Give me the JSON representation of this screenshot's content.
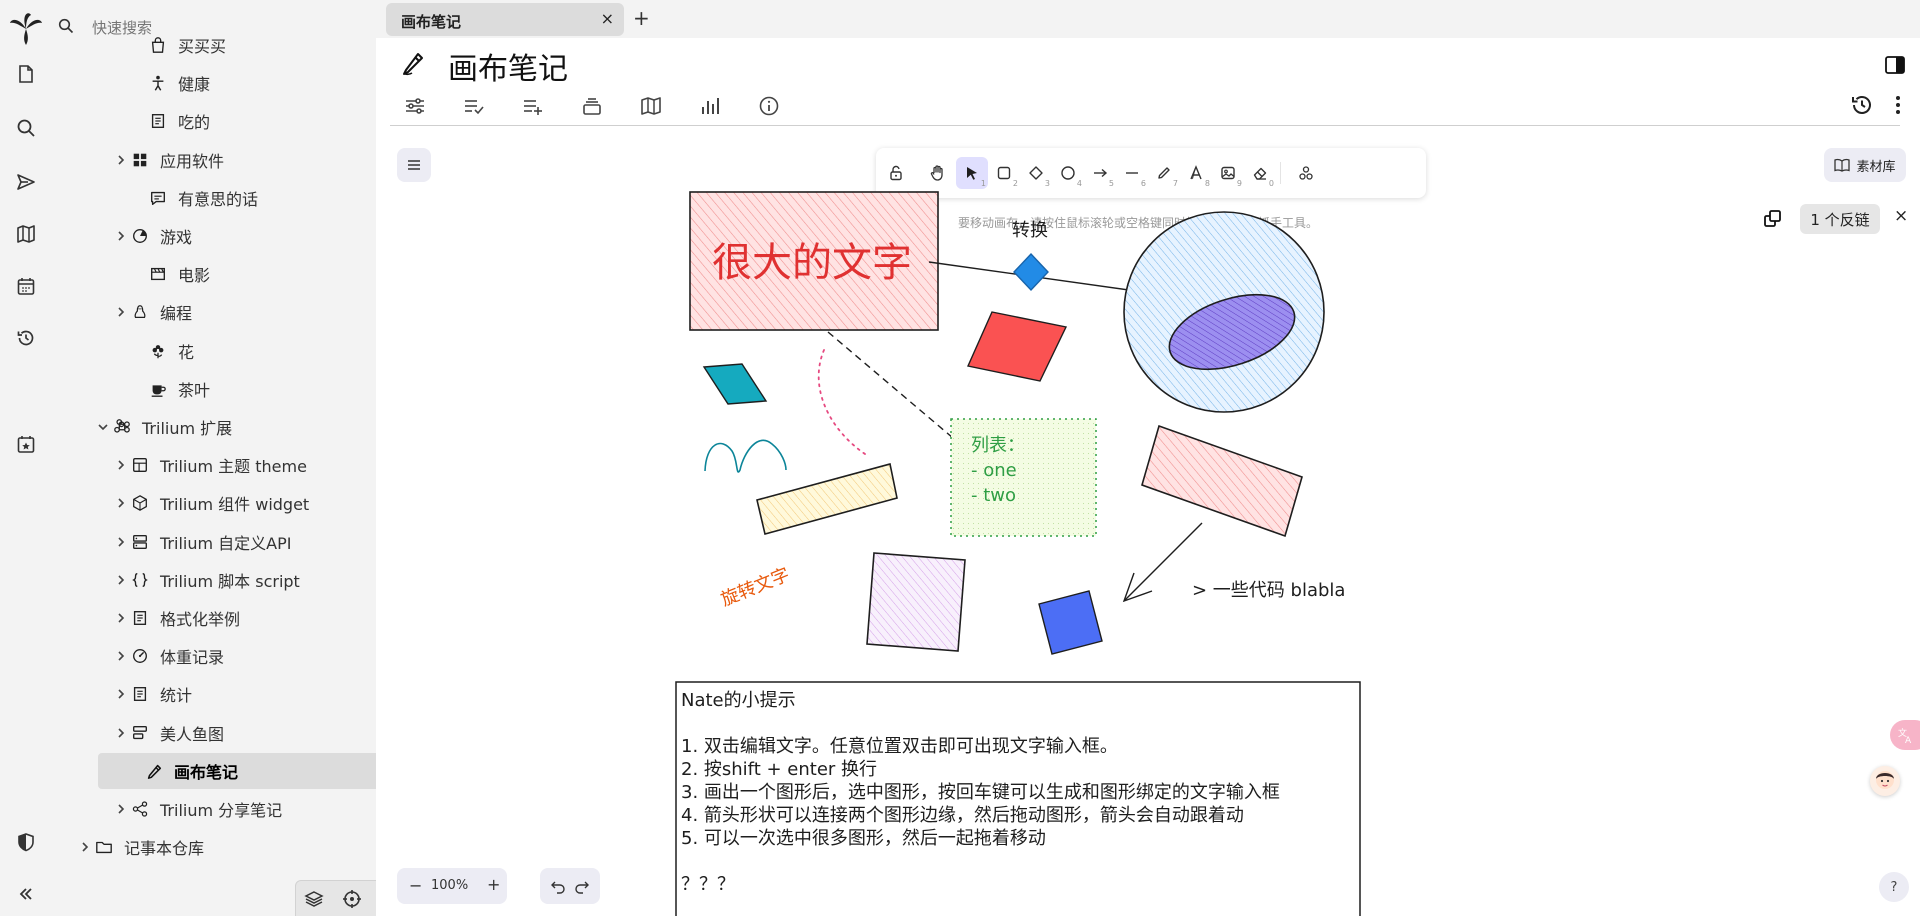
{
  "search": {
    "placeholder": "快速搜索"
  },
  "tree": {
    "items": [
      {
        "label": "买买买",
        "expandable": false
      },
      {
        "label": "健康",
        "expandable": false
      },
      {
        "label": "吃的",
        "expandable": false
      },
      {
        "label": "应用软件",
        "expandable": true
      },
      {
        "label": "有意思的话",
        "expandable": false
      },
      {
        "label": "游戏",
        "expandable": true
      },
      {
        "label": "电影",
        "expandable": false
      },
      {
        "label": "编程",
        "expandable": true
      },
      {
        "label": "花",
        "expandable": false
      },
      {
        "label": "茶叶",
        "expandable": false
      },
      {
        "label": "Trilium 扩展",
        "expanded": true
      },
      {
        "label": "Trilium 主题 theme",
        "expandable": true
      },
      {
        "label": "Trilium 组件 widget",
        "expandable": true
      },
      {
        "label": "Trilium 自定义API",
        "expandable": true
      },
      {
        "label": "Trilium 脚本 script",
        "expandable": true
      },
      {
        "label": "格式化举例",
        "expandable": true
      },
      {
        "label": "体重记录",
        "expandable": true
      },
      {
        "label": "统计",
        "expandable": true
      },
      {
        "label": "美人鱼图",
        "expandable": true
      },
      {
        "label": "画布笔记",
        "active": true
      },
      {
        "label": "Trilium 分享笔记",
        "expandable": true
      },
      {
        "label": "记事本仓库",
        "expandable": true
      }
    ]
  },
  "tab": {
    "title": "画布笔记",
    "close": "×",
    "new": "+"
  },
  "note": {
    "title": "画布笔记"
  },
  "canvas": {
    "hint": "要移动画布，请按住鼠标滚轮或空格键同时拖拽，或使用抓手工具。",
    "library_label": "素材库",
    "backlinks": "1 个反链",
    "backlinks_close": "×",
    "zoom": "100%",
    "zoom_minus": "−",
    "zoom_plus": "+",
    "help": "?",
    "tool_numbers": [
      "1",
      "2",
      "3",
      "4",
      "5",
      "6",
      "7",
      "8",
      "9",
      "0"
    ],
    "texts": {
      "big_text": "很大的文字",
      "convert": "转换",
      "list_title": "列表：",
      "list_item_1": "- one",
      "list_item_2": "- two",
      "rotated": "旋转文字",
      "code": "> 一些代码 blabla",
      "tips_title": "Nate的小提示",
      "tip1": "1. 双击编辑文字。任意位置双击即可出现文字输入框。",
      "tip2": "2. 按shift + enter 换行",
      "tip3": "3. 画出一个图形后，选中图形，按回车键可以生成和图形绑定的文字输入框",
      "tip4": "4. 箭头形状可以连接两个图形边缘，然后拖动图形，箭头会自动跟着动",
      "tip5": "5. 可以一次选中很多图形，然后一起拖着移动",
      "tip_end": "？？？"
    }
  },
  "colors": {
    "accent": "#6965db",
    "active_tree": "#dcdcdc",
    "panel_bg": "#f3f3f3",
    "text_red": "#e03131",
    "text_green": "#2f9e44",
    "text_orange": "#e8590c"
  }
}
